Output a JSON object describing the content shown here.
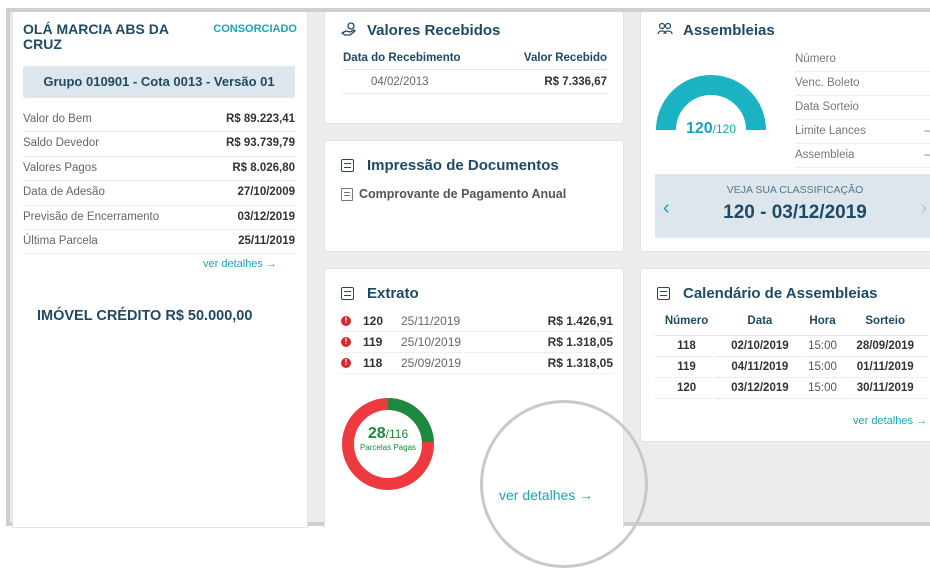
{
  "user": {
    "greeting": "OLÁ MARCIA ABS DA CRUZ",
    "tag": "CONSORCIADO",
    "group": "Grupo 010901 - Cota 0013 - Versão 01"
  },
  "summary": [
    {
      "label": "Valor do Bem",
      "value": "R$ 89.223,41"
    },
    {
      "label": "Saldo Devedor",
      "value": "R$ 93.739,79"
    },
    {
      "label": "Valores Pagos",
      "value": "R$ 8.026,80"
    },
    {
      "label": "Data de Adesão",
      "value": "27/10/2009"
    },
    {
      "label": "Previsão de Encerramento",
      "value": "03/12/2019"
    },
    {
      "label": "Última Parcela",
      "value": "25/11/2019"
    }
  ],
  "summary_link": "ver detalhes →",
  "credit": "IMÓVEL CRÉDITO R$ 50.000,00",
  "valores": {
    "title": "Valores Recebidos",
    "col_date": "Data do Recebimento",
    "col_value": "Valor Recebido",
    "rows": [
      {
        "date": "04/02/2013",
        "value": "R$ 7.336,67"
      }
    ]
  },
  "impressao": {
    "title": "Impressão de Documentos",
    "item": "Comprovante de Pagamento Anual"
  },
  "extrato": {
    "title": "Extrato",
    "rows": [
      {
        "alert": "!",
        "num": "120",
        "date": "25/11/2019",
        "value": "R$ 1.426,91"
      },
      {
        "alert": "!",
        "num": "119",
        "date": "25/10/2019",
        "value": "R$ 1.318,05"
      },
      {
        "alert": "!",
        "num": "118",
        "date": "25/09/2019",
        "value": "R$ 1.318,05"
      }
    ],
    "paid": "28",
    "total": "/116",
    "paid_fraction": 0.2414,
    "paid_label": "Parcelas Pagas",
    "link": "ver detalhes →",
    "colors": {
      "paid": "#1b8a3c",
      "unpaid": "#ee3a3f"
    }
  },
  "assembleias": {
    "title": "Assembleias",
    "gauge_value": "120",
    "gauge_total": "/120",
    "gauge_fraction": 1,
    "gauge_color": "#1ab3c4",
    "rows": [
      {
        "label": "Número",
        "value": ""
      },
      {
        "label": "Venc. Boleto",
        "value": ""
      },
      {
        "label": "Data Sorteio",
        "value": ""
      },
      {
        "label": "Limite Lances",
        "value": "–"
      },
      {
        "label": "Assembleia",
        "value": "–"
      }
    ],
    "rank_label": "VEJA SUA CLASSIFICAÇÃO",
    "rank_value": "120 - 03/12/2019",
    "prev": "‹",
    "next": "›"
  },
  "calendario": {
    "title": "Calendário de Assembleias",
    "headers": [
      "Número",
      "Data",
      "Hora",
      "Sorteio"
    ],
    "rows": [
      [
        "118",
        "02/10/2019",
        "15:00",
        "28/09/2019"
      ],
      [
        "119",
        "04/11/2019",
        "15:00",
        "01/11/2019"
      ],
      [
        "120",
        "03/12/2019",
        "15:00",
        "30/11/2019"
      ]
    ],
    "link": "ver detalhes →"
  }
}
